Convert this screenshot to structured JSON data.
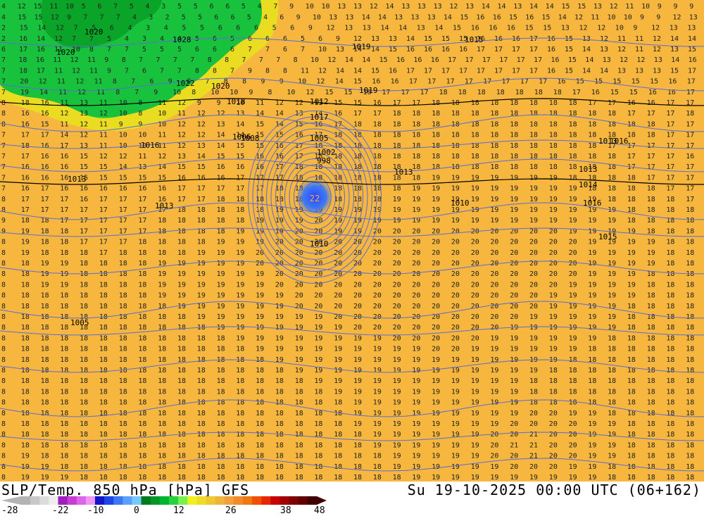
{
  "title_left": "SLP/Temp. 850 hPa [hPa] GFS",
  "title_right": "Su 19-10-2025 00:00 UTC (06+162)",
  "colorbar": {
    "colors": [
      "#b4b4b4",
      "#c8c8c8",
      "#dcdcdc",
      "#eeeeee",
      "#9e1ebe",
      "#c83cd2",
      "#dc64e6",
      "#f096f5",
      "#1414c8",
      "#1e46e6",
      "#3c78f5",
      "#5aa0ff",
      "#78c8ff",
      "#00781e",
      "#009628",
      "#00b432",
      "#28d23c",
      "#78f050",
      "#f0f01e",
      "#f0dc28",
      "#f0c832",
      "#f0b43c",
      "#f0a03c",
      "#f08c28",
      "#f07814",
      "#f05000",
      "#e62800",
      "#c80000",
      "#a00000",
      "#800000",
      "#600000",
      "#400000"
    ],
    "labels": [
      "-28",
      "-22",
      "-10",
      "0",
      "12",
      "26",
      "38",
      "48"
    ]
  },
  "map": {
    "colors": {
      "warm": "#f7b23b",
      "warm_light": "#f9c244",
      "cool": "#19c23c",
      "cool_dark": "#0aa528",
      "yellow": "#e8e11e",
      "isobar": "#5b6cd6",
      "isobar_dark": "#000000",
      "low_center": "#2a46ff"
    },
    "pressure_labels": [
      "1020",
      "1028",
      "1019",
      "1020",
      "1022",
      "1020",
      "1018",
      "1015",
      "1016",
      "1012",
      "1013",
      "1017",
      "1016",
      "1008",
      "1005",
      "1002",
      "998",
      "1019",
      "1013",
      "1014",
      "1013",
      "1016",
      "1013",
      "1015",
      "1010",
      "1005",
      "1013",
      "1010",
      "1006",
      "1016"
    ],
    "low_label": "22",
    "grid_rows": [
      "4 12 15 11 10 5 6 7 5 4 3 5 5 6 6 5 4 7 9 10 10 13 13 12 14 13 13 13 12 13 14 14 13 14 14 15 15 13 12 11 10 9 9 9",
      "4 15 15 12 9 7 7 7 4 3 2 5 5 6 6 5 4 6 9 10 13 13 14 14 13 13 13 14 15 16 16 15 16 15 14 12 11 10 10 9 9 12 13",
      "2 15 14 12 7 5 6 4 3 4 5 5 6 6 6 5 6 9 12 13 13 14 14 13 14 15 16 16 16 15 15 13 12 12 10 9 12 13 13",
      "2 16 14 12 7 7 5 4 3 4 4 5 6 5 6 6 6 5 6 9 12 13 13 14 15 15 15 16 16 16 17 16 15 13 12 11 11 12 14 14",
      "6 17 16 11 10 8 7 7 5 5 5 6 6 6 7 7 6 7 10 13 14 14 15 16 16 16 16 17 17 17 17 16 15 14 13 12 11 12 13 15",
      "7 18 16 11 12 11 9 8 7 7 7 7 8 8 7 7 7 8 10 12 14 14 15 16 16 16 17 17 17 17 17 17 16 15 14 13 12 12 13 14 16",
      "7 18 17 11 12 11 9 7 6 7 7 8 8 7 9 8 8 11 12 14 14 15 16 17 17 17 17 17 17 17 17 16 15 14 14 13 13 13 15 17",
      "7 20 12 11 12 11 8 7 6 9 8 7 8 8 9 9 10 12 14 15 16 16 17 17 17 17 17 17 17 17 16 15 15 15 15 15 16 17",
      "7 19 14 11 12 11 8 7 9 10 8 10 10 9 8 10 12 15 15 16 17 17 17 18 18 18 18 18 18 18 17 16 15 15 16 16 17",
      "8 18 16 11 13 11 10 8 11 12 9 9 10 11 12 12 13 15 15 16 17 17 18 18 18 18 18 18 18 18 17 17 16 16 17 17",
      "8 16 16 12 13 12 10 8 10 11 12 12 13 14 14 13 14 16 17 17 18 18 18 18 18 18 18 18 18 18 18 18 17 17 17 18",
      "8 16 15 11 12 11 9 9 10 12 12 13 14 15 14 15 16 17 18 18 18 18 18 18 18 18 18 18 18 18 18 18 18 18 17 17",
      "7 17 17 14 12 11 10 10 11 12 12 14 14 15 15 16 17 18 18 18 18 18 18 18 18 18 18 18 18 18 18 18 18 18 17 17",
      "7 18 16 17 13 11 10 10 11 12 13 14 15 15 16 17 18 18 18 18 18 18 18 18 18 18 18 18 18 18 18 17 17 17 17 17",
      "7 17 16 16 15 12 12 11 12 13 14 15 15 16 16 17 18 18 18 18 18 18 18 18 18 18 18 18 18 18 18 18 17 17 17 16",
      "7 16 16 16 15 15 14 13 14 15 15 16 16 16 17 18 18 18 18 18 18 18 18 18 18 18 18 18 18 18 18 18 17 17 17 17",
      "7 16 16 16 15 15 15 15 15 16 16 16 17 17 17 18 18 18 18 18 18 18 19 19 19 19 19 19 19 18 18 18 18 17 17 17",
      "7 16 17 16 16 16 16 16 16 17 17 17 17 17 18 18 18 18 18 18 18 19 19 19 19 19 19 19 19 19 18 18 18 18 17 17",
      "8 17 17 17 16 17 17 17 16 17 17 18 18 18 18 18 18 18 18 18 19 19 19 19 19 19 19 19 19 19 19 18 18 18 18 17",
      "8 17 17 17 17 17 17 17 17 18 18 18 18 18 19 19 19 19 19 19 19 19 19 19 19 19 19 19 19 19 19 19 18 18 18 18",
      "9 18 18 17 17 17 17 17 18 18 18 18 18 19 19 19 20 19 19 19 19 19 19 19 19 19 19 19 19 19 19 19 18 18 18 18",
      "9 19 18 18 17 17 17 17 18 18 18 18 19 19 19 20 20 19 19 20 20 20 20 20 20 20 20 20 20 19 19 19 19 18 18 18",
      "8 19 18 18 17 17 17 18 18 18 18 19 19 19 20 20 20 20 20 20 20 20 20 20 20 20 20 20 20 20 19 19 19 19 18 18",
      "8 19 18 18 18 17 18 18 18 18 19 19 19 20 20 20 20 20 20 20 20 20 20 20 20 20 20 20 20 20 19 19 19 19 18 18",
      "8 18 19 19 18 18 18 18 19 19 19 19 19 20 20 20 20 20 20 20 20 20 20 20 20 20 20 20 20 20 19 19 19 19 18 18",
      "8 18 19 19 18 18 18 18 19 19 19 19 19 19 20 20 20 20 20 20 20 20 20 20 20 20 20 20 20 20 19 19 19 18 18 18",
      "8 18 19 19 18 18 18 18 19 19 19 19 19 19 20 20 20 20 20 20 20 20 20 20 20 20 20 20 20 19 19 19 19 18 18 18",
      "8 18 18 18 18 18 18 18 19 19 19 19 19 19 19 20 20 20 20 20 20 20 20 20 20 20 20 20 19 19 19 19 19 18 18 18",
      "8 18 18 18 18 18 18 18 18 19 19 19 19 19 19 20 20 20 20 20 20 20 20 20 20 20 20 20 19 19 19 19 18 18 18 18",
      "8 18 18 18 18 18 18 18 18 18 19 19 19 19 19 19 19 20 20 20 20 20 20 20 20 20 20 19 19 19 19 19 18 18 18 18",
      "8 18 18 18 18 18 18 18 18 18 18 19 19 19 19 19 19 19 20 20 20 20 20 20 20 20 19 19 19 19 19 19 18 18 18 18",
      "8 18 18 18 18 18 18 18 18 18 18 18 19 19 19 19 19 19 19 19 20 20 20 20 20 19 19 19 19 19 19 18 18 18 18 18",
      "8 18 18 18 18 18 18 18 18 18 18 18 18 19 19 19 19 19 19 19 19 19 20 20 19 19 19 19 19 19 18 18 18 18 18 18",
      "8 18 18 18 18 18 18 18 18 18 18 18 18 18 19 19 19 19 19 19 19 19 19 19 19 19 19 19 19 18 18 18 18 18 18 18",
      "8 18 18 18 18 18 18 18 18 18 18 18 18 18 18 19 19 19 19 19 19 19 19 19 19 19 19 19 18 18 18 18 18 18 18 18",
      "8 18 18 18 18 18 18 18 18 18 18 18 18 18 18 18 19 19 19 19 19 19 19 19 19 19 19 18 18 18 18 18 18 18 18 18",
      "8 18 18 18 18 18 18 18 18 18 18 18 18 18 18 18 18 19 19 19 19 19 19 19 19 19 19 18 18 18 18 18 18 18 18 18",
      "8 18 18 18 18 18 18 18 18 18 18 18 18 18 18 18 18 18 19 19 19 19 19 19 19 19 19 18 18 18 18 18 18 18 18 18",
      "8 18 18 18 18 18 18 18 18 18 18 18 18 18 18 18 18 18 19 19 19 19 19 19 19 19 19 20 20 19 19 18 18 18 18 18",
      "8 18 18 18 18 18 18 18 18 18 18 18 18 18 18 18 18 18 19 19 19 19 19 19 19 19 20 20 20 20 19 19 18 18 18 18",
      "8 18 18 18 18 18 18 18 18 18 18 18 18 18 18 18 18 18 18 19 19 19 19 19 19 20 20 21 20 20 19 19 18 18 18 18",
      "8 18 18 18 18 18 18 18 18 18 18 18 18 18 18 18 18 18 18 19 19 19 19 19 19 20 21 21 20 20 19 19 18 18 18 18",
      "8 19 18 18 18 18 18 18 18 18 18 18 18 18 18 18 18 18 18 18 19 19 19 19 19 20 20 21 20 20 19 19 18 18 18 18",
      "8 19 19 18 18 18 18 18 18 18 18 18 18 18 18 18 18 18 18 18 19 19 19 19 19 19 20 20 20 19 19 18 18 18 18 18",
      "8 19 19 19 18 18 18 18 18 18 18 18 18 18 18 18 18 18 18 18 18 19 19 19 19 19 19 19 19 19 19 18 18 18 18 18"
    ]
  }
}
